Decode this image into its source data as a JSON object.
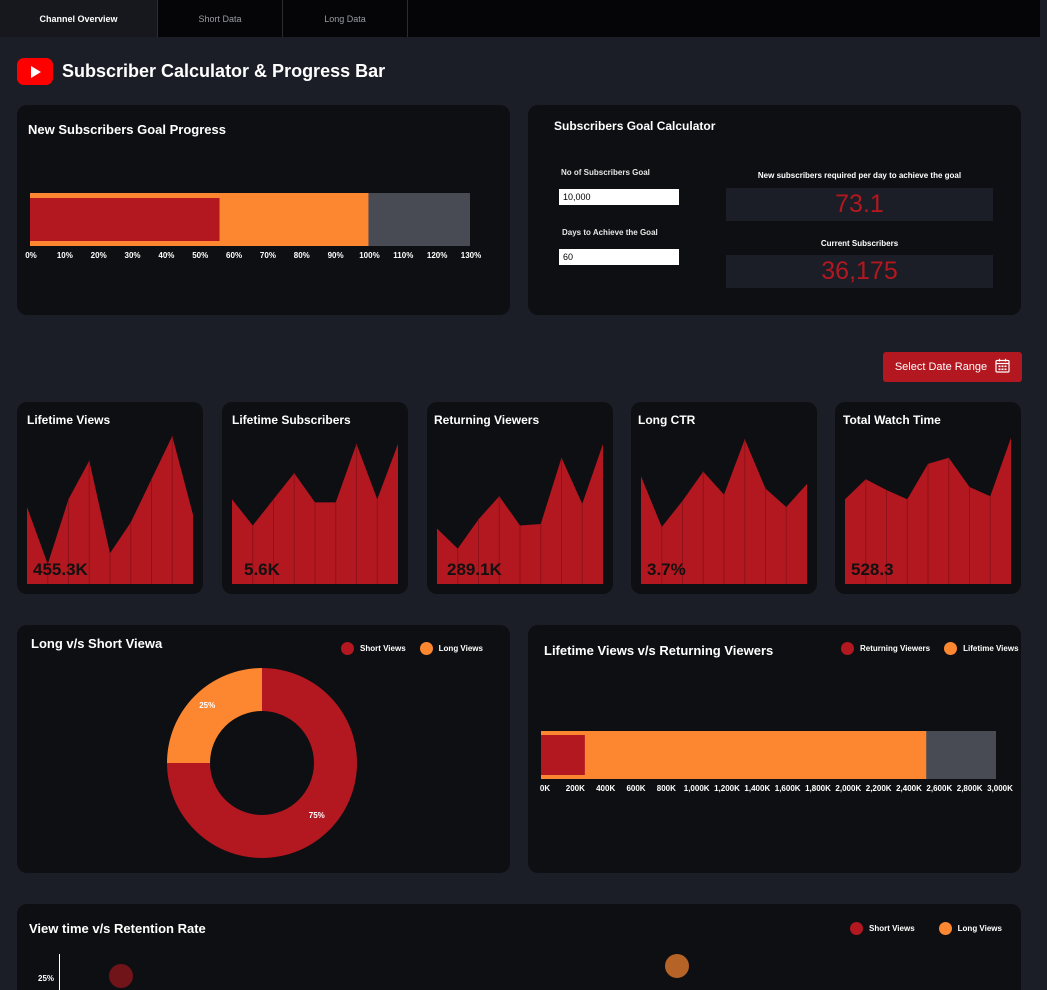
{
  "tabs": [
    {
      "label": "Channel Overview",
      "active": true
    },
    {
      "label": "Short Data",
      "active": false
    },
    {
      "label": "Long Data",
      "active": false
    }
  ],
  "page_title": "Subscriber Calculator & Progress Bar",
  "colors": {
    "red": "#b3171f",
    "orange": "#fd8731",
    "gray": "#484b54",
    "card": "#0e0f12",
    "bg": "#1b1e26"
  },
  "goal_progress": {
    "title": "New Subscribers Goal Progress",
    "axis": [
      "0%",
      "10%",
      "20%",
      "30%",
      "40%",
      "50%",
      "60%",
      "70%",
      "80%",
      "90%",
      "100%",
      "110%",
      "120%",
      "130%"
    ],
    "actual_pct": 56,
    "target_pct": 100,
    "max_pct": 130
  },
  "calculator": {
    "title": "Subscribers Goal Calculator",
    "goal_label": "No of Subscribers Goal",
    "goal_value": "10,000",
    "days_label": "Days to Achieve the Goal",
    "days_value": "60",
    "per_day_label": "New subscribers required per day to achieve the goal",
    "per_day_value": "73.1",
    "current_label": "Current Subscribers",
    "current_value": "36,175"
  },
  "date_button": {
    "label": "Select Date Range",
    "icon": "calendar-icon"
  },
  "kpis": [
    {
      "title": "Lifetime Views",
      "value": "455.3K",
      "trend": [
        0.5,
        0.13,
        0.55,
        0.8,
        0.2,
        0.4,
        0.68,
        0.96,
        0.45
      ]
    },
    {
      "title": "Lifetime Subscribers",
      "value": "5.6K",
      "trend": [
        0.55,
        0.38,
        0.55,
        0.72,
        0.53,
        0.53,
        0.91,
        0.55,
        0.91
      ]
    },
    {
      "title": "Returning Viewers",
      "value": "289.1K",
      "trend": [
        0.36,
        0.23,
        0.42,
        0.57,
        0.38,
        0.39,
        0.82,
        0.52,
        0.91
      ]
    },
    {
      "title": "Long CTR",
      "value": "3.7%",
      "trend": [
        0.7,
        0.37,
        0.54,
        0.73,
        0.58,
        0.94,
        0.62,
        0.5,
        0.65
      ]
    },
    {
      "title": "Total Watch Time",
      "value": "528.3",
      "trend": [
        0.55,
        0.68,
        0.61,
        0.55,
        0.78,
        0.82,
        0.63,
        0.57,
        0.95
      ]
    }
  ],
  "donut": {
    "title": "Long v/s Short Viewa",
    "legend": [
      {
        "name": "Short Views",
        "color": "#b3171f"
      },
      {
        "name": "Long Views",
        "color": "#fd8731"
      }
    ],
    "slices": [
      {
        "name": "Short Views",
        "pct": 75,
        "label": "75%"
      },
      {
        "name": "Long Views",
        "pct": 25,
        "label": "25%"
      }
    ]
  },
  "lifetime_bar": {
    "title": "Lifetime Views v/s Returning Viewers",
    "legend": [
      {
        "name": "Returning Viewers",
        "color": "#b3171f"
      },
      {
        "name": "Lifetime Views",
        "color": "#fd8731"
      }
    ],
    "axis": [
      "0K",
      "200K",
      "400K",
      "600K",
      "800K",
      "1,000K",
      "1,200K",
      "1,400K",
      "1,600K",
      "1,800K",
      "2,000K",
      "2,200K",
      "2,400K",
      "2,600K",
      "2,800K",
      "3,000K"
    ],
    "returning_value": 289100,
    "lifetime_value": 2540000,
    "max_value": 3000000
  },
  "retention": {
    "title": "View time v/s Retention Rate",
    "legend": [
      {
        "name": "Short Views",
        "color": "#b3171f"
      },
      {
        "name": "Long Views",
        "color": "#fd8731"
      }
    ],
    "y_tick": "25%"
  }
}
